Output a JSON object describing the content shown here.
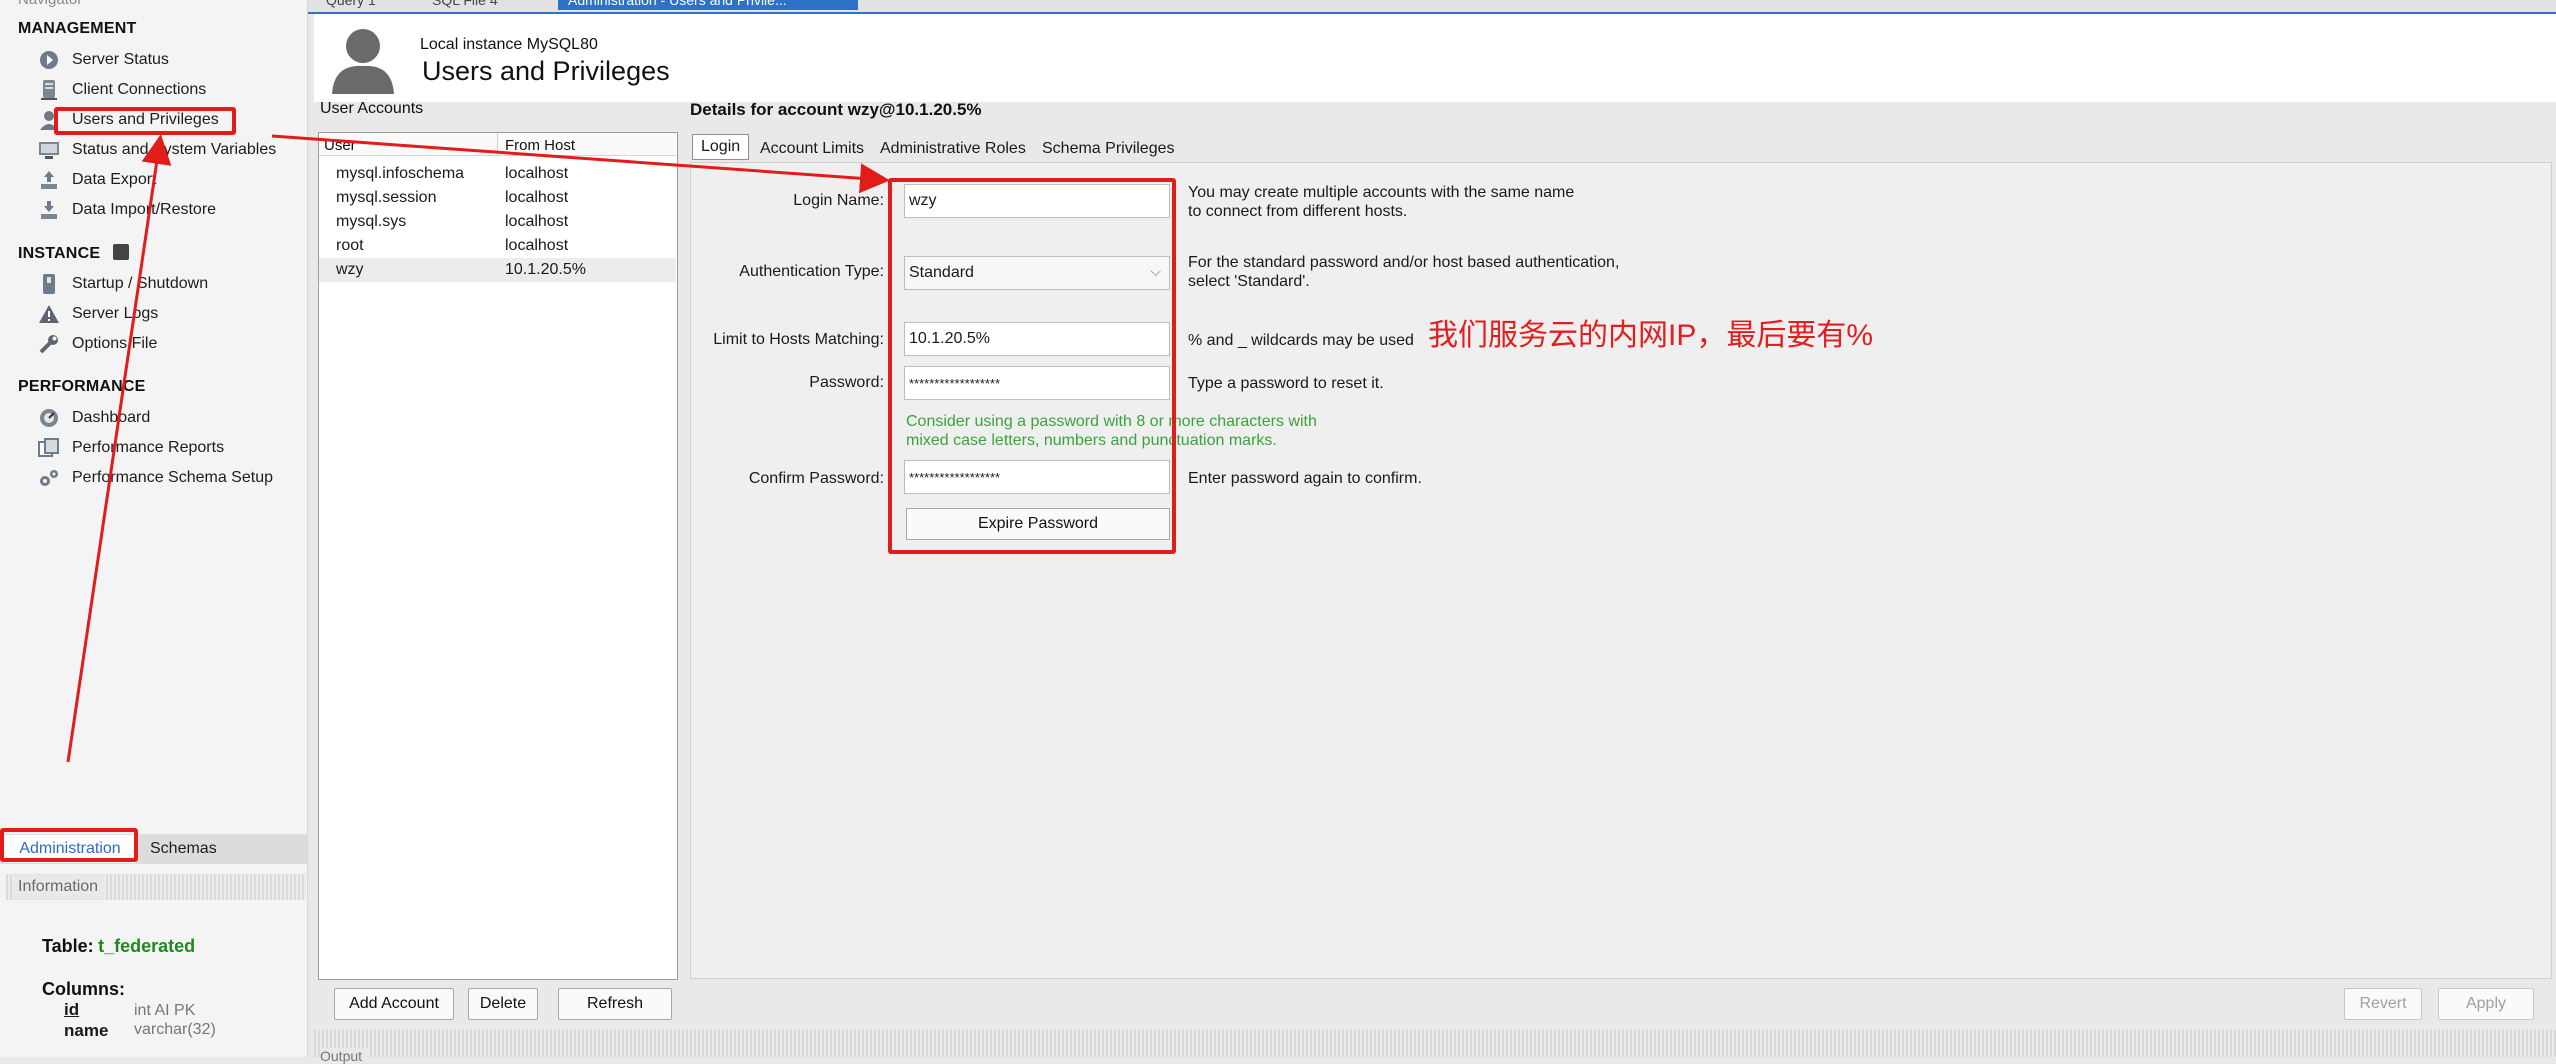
{
  "navigator": {
    "title": "Navigator",
    "sections": {
      "management": "MANAGEMENT",
      "instance": "INSTANCE",
      "performance": "PERFORMANCE"
    },
    "management_items": [
      {
        "label": "Server Status",
        "icon": "server-status-icon"
      },
      {
        "label": "Client Connections",
        "icon": "client-connections-icon"
      },
      {
        "label": "Users and Privileges",
        "icon": "user-icon"
      },
      {
        "label": "Status and System Variables",
        "icon": "monitor-icon"
      },
      {
        "label": "Data Export",
        "icon": "export-icon"
      },
      {
        "label": "Data Import/Restore",
        "icon": "import-icon"
      }
    ],
    "instance_items": [
      {
        "label": "Startup / Shutdown",
        "icon": "power-icon"
      },
      {
        "label": "Server Logs",
        "icon": "warning-icon"
      },
      {
        "label": "Options File",
        "icon": "wrench-icon"
      }
    ],
    "performance_items": [
      {
        "label": "Dashboard",
        "icon": "dashboard-icon"
      },
      {
        "label": "Performance Reports",
        "icon": "reports-icon"
      },
      {
        "label": "Performance Schema Setup",
        "icon": "settings-icon"
      }
    ],
    "tabs": {
      "administration": "Administration",
      "schemas": "Schemas"
    },
    "information": {
      "title": "Information",
      "table_label": "Table:",
      "table_name": "t_federated",
      "columns_label": "Columns:",
      "columns": [
        {
          "name": "id",
          "type": "int AI PK"
        },
        {
          "name": "name",
          "type": "varchar(32)"
        }
      ]
    }
  },
  "top_tabs": {
    "tab1": "Query 1",
    "tab2": "SQL File 4",
    "active": "Administration - Users and Privile..."
  },
  "header": {
    "subtitle": "Local instance MySQL80",
    "title": "Users and Privileges"
  },
  "accounts": {
    "label": "User Accounts",
    "columns": {
      "user": "User",
      "host": "From Host"
    },
    "rows": [
      {
        "user": "mysql.infoschema",
        "host": "localhost"
      },
      {
        "user": "mysql.session",
        "host": "localhost"
      },
      {
        "user": "mysql.sys",
        "host": "localhost"
      },
      {
        "user": "root",
        "host": "localhost"
      },
      {
        "user": "wzy",
        "host": "10.1.20.5%"
      }
    ],
    "buttons": {
      "add": "Add Account",
      "delete": "Delete",
      "refresh": "Refresh"
    }
  },
  "details": {
    "title": "Details for account wzy@10.1.20.5%",
    "tabs": [
      "Login",
      "Account Limits",
      "Administrative Roles",
      "Schema Privileges"
    ],
    "fields": {
      "login_name": {
        "label": "Login Name:",
        "value": "wzy",
        "hint1": "You may create multiple accounts with the same name",
        "hint2": "to connect from different hosts."
      },
      "auth_type": {
        "label": "Authentication Type:",
        "value": "Standard",
        "hint1": "For the standard password and/or host based authentication,",
        "hint2": "select 'Standard'."
      },
      "hosts": {
        "label": "Limit to Hosts Matching:",
        "value": "10.1.20.5%",
        "hint": "% and _ wildcards may be used"
      },
      "password": {
        "label": "Password:",
        "value": "******************",
        "hint": "Type a password to reset it."
      },
      "advice1": "Consider using a password with 8 or more characters with",
      "advice2": "mixed case letters, numbers and punctuation marks.",
      "confirm": {
        "label": "Confirm Password:",
        "value": "******************",
        "hint": "Enter password again to confirm."
      },
      "expire_button": "Expire Password"
    },
    "buttons": {
      "revert": "Revert",
      "apply": "Apply"
    }
  },
  "annotation": {
    "note": "我们服务云的内网IP，最后要有%",
    "color": "#e21b1b"
  },
  "output": {
    "label": "Output"
  }
}
